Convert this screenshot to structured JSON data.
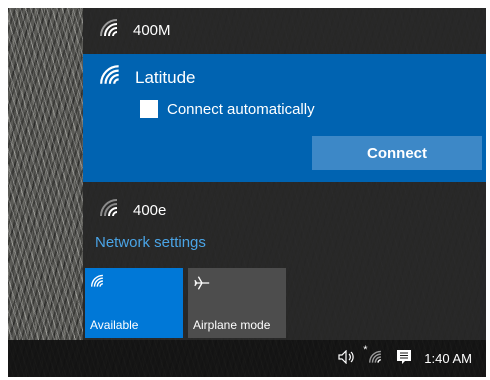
{
  "networks": {
    "top": {
      "name": "400M",
      "icon": "wifi-signal-icon"
    },
    "selected": {
      "name": "Latitude",
      "icon": "wifi-signal-icon",
      "auto_label": "Connect automatically",
      "auto_checked": false,
      "connect_label": "Connect"
    },
    "bottom": {
      "name": "400e",
      "icon": "wifi-signal-icon"
    }
  },
  "settings_link": "Network settings",
  "tiles": {
    "available": {
      "label": "Available",
      "icon": "wifi-icon",
      "active": true
    },
    "airplane": {
      "label": "Airplane mode",
      "icon": "airplane-icon",
      "active": false
    }
  },
  "taskbar": {
    "clock": "1:40 AM",
    "tray_icons": [
      "speaker-icon",
      "wifi-status-icon",
      "action-center-icon"
    ]
  },
  "colors": {
    "accent": "#0063b1",
    "button": "#3d88c7",
    "link": "#4aa4e6",
    "tile_active": "#0078d7",
    "tile_inactive": "#4d4d4d",
    "flyout_bg": "#262626"
  }
}
